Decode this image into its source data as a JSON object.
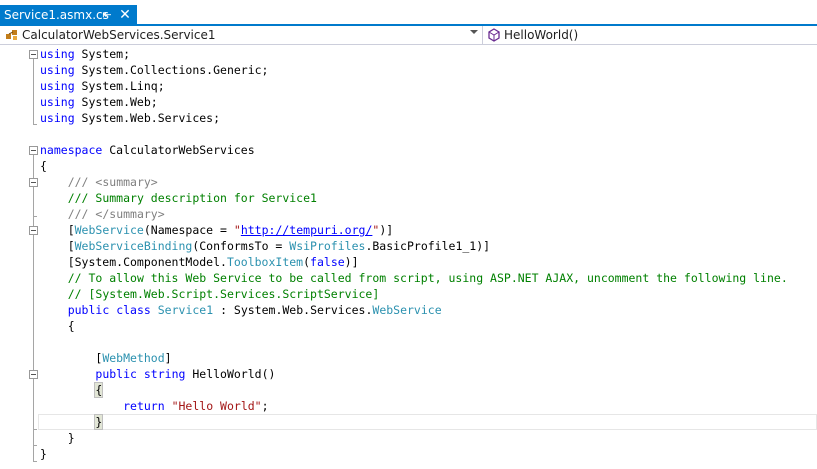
{
  "tab": {
    "title": "Service1.asmx.cs",
    "pin_icon": "pin-icon",
    "close_icon": "close-icon"
  },
  "nav": {
    "class_dropdown": {
      "label": "CalculatorWebServices.Service1",
      "icon": "class-icon"
    },
    "member_dropdown": {
      "label": "HelloWorld()",
      "icon": "method-icon"
    }
  },
  "colors": {
    "accent": "#007acc",
    "keyword": "#0000ff",
    "type": "#2b91af",
    "comment": "#008000",
    "string": "#a31515",
    "xmldoc": "#808080"
  },
  "code": [
    [
      {
        "t": "using",
        "c": "kw"
      },
      {
        "t": " System;",
        "c": ""
      }
    ],
    [
      {
        "t": "using",
        "c": "kw"
      },
      {
        "t": " System.Collections.Generic;",
        "c": ""
      }
    ],
    [
      {
        "t": "using",
        "c": "kw"
      },
      {
        "t": " System.Linq;",
        "c": ""
      }
    ],
    [
      {
        "t": "using",
        "c": "kw"
      },
      {
        "t": " System.Web;",
        "c": ""
      }
    ],
    [
      {
        "t": "using",
        "c": "kw"
      },
      {
        "t": " System.Web.Services;",
        "c": ""
      }
    ],
    [],
    [
      {
        "t": "namespace",
        "c": "kw"
      },
      {
        "t": " CalculatorWebServices",
        "c": ""
      }
    ],
    [
      {
        "t": "{",
        "c": ""
      }
    ],
    [
      {
        "t": "    ",
        "c": ""
      },
      {
        "t": "///",
        "c": "xd"
      },
      {
        "t": " ",
        "c": "cm"
      },
      {
        "t": "<summary>",
        "c": "xd"
      }
    ],
    [
      {
        "t": "    ",
        "c": ""
      },
      {
        "t": "/// Summary description for Service1",
        "c": "cm"
      }
    ],
    [
      {
        "t": "    ",
        "c": ""
      },
      {
        "t": "///",
        "c": "xd"
      },
      {
        "t": " ",
        "c": "cm"
      },
      {
        "t": "</summary>",
        "c": "xd"
      }
    ],
    [
      {
        "t": "    [",
        "c": ""
      },
      {
        "t": "WebService",
        "c": "ty"
      },
      {
        "t": "(Namespace = ",
        "c": ""
      },
      {
        "t": "\"",
        "c": "st"
      },
      {
        "t": "http://tempuri.org/",
        "c": "lk"
      },
      {
        "t": "\"",
        "c": "st"
      },
      {
        "t": ")]",
        "c": ""
      }
    ],
    [
      {
        "t": "    [",
        "c": ""
      },
      {
        "t": "WebServiceBinding",
        "c": "ty"
      },
      {
        "t": "(ConformsTo = ",
        "c": ""
      },
      {
        "t": "WsiProfiles",
        "c": "ty"
      },
      {
        "t": ".BasicProfile1_1)]",
        "c": ""
      }
    ],
    [
      {
        "t": "    [System.ComponentModel.",
        "c": ""
      },
      {
        "t": "ToolboxItem",
        "c": "ty"
      },
      {
        "t": "(",
        "c": ""
      },
      {
        "t": "false",
        "c": "kw"
      },
      {
        "t": ")]",
        "c": ""
      }
    ],
    [
      {
        "t": "    ",
        "c": ""
      },
      {
        "t": "// To allow this Web Service to be called from script, using ASP.NET AJAX, uncomment the following line.",
        "c": "cm"
      }
    ],
    [
      {
        "t": "    ",
        "c": ""
      },
      {
        "t": "// [System.Web.Script.Services.ScriptService]",
        "c": "cm"
      }
    ],
    [
      {
        "t": "    ",
        "c": ""
      },
      {
        "t": "public",
        "c": "kw"
      },
      {
        "t": " ",
        "c": ""
      },
      {
        "t": "class",
        "c": "kw"
      },
      {
        "t": " ",
        "c": ""
      },
      {
        "t": "Service1",
        "c": "ty"
      },
      {
        "t": " : System.Web.Services.",
        "c": ""
      },
      {
        "t": "WebService",
        "c": "ty"
      }
    ],
    [
      {
        "t": "    {",
        "c": ""
      }
    ],
    [],
    [
      {
        "t": "        [",
        "c": ""
      },
      {
        "t": "WebMethod",
        "c": "ty"
      },
      {
        "t": "]",
        "c": ""
      }
    ],
    [
      {
        "t": "        ",
        "c": ""
      },
      {
        "t": "public",
        "c": "kw"
      },
      {
        "t": " ",
        "c": ""
      },
      {
        "t": "string",
        "c": "kw"
      },
      {
        "t": " HelloWorld()",
        "c": ""
      }
    ],
    [
      {
        "t": "        ",
        "c": ""
      },
      {
        "t": "{",
        "c": "bm"
      }
    ],
    [
      {
        "t": "            ",
        "c": ""
      },
      {
        "t": "return",
        "c": "kw"
      },
      {
        "t": " ",
        "c": ""
      },
      {
        "t": "\"Hello World\"",
        "c": "st"
      },
      {
        "t": ";",
        "c": ""
      }
    ],
    [
      {
        "t": "        ",
        "c": ""
      },
      {
        "t": "}",
        "c": "bm"
      }
    ],
    [
      {
        "t": "    }",
        "c": ""
      }
    ],
    [
      {
        "t": "}",
        "c": ""
      }
    ]
  ]
}
